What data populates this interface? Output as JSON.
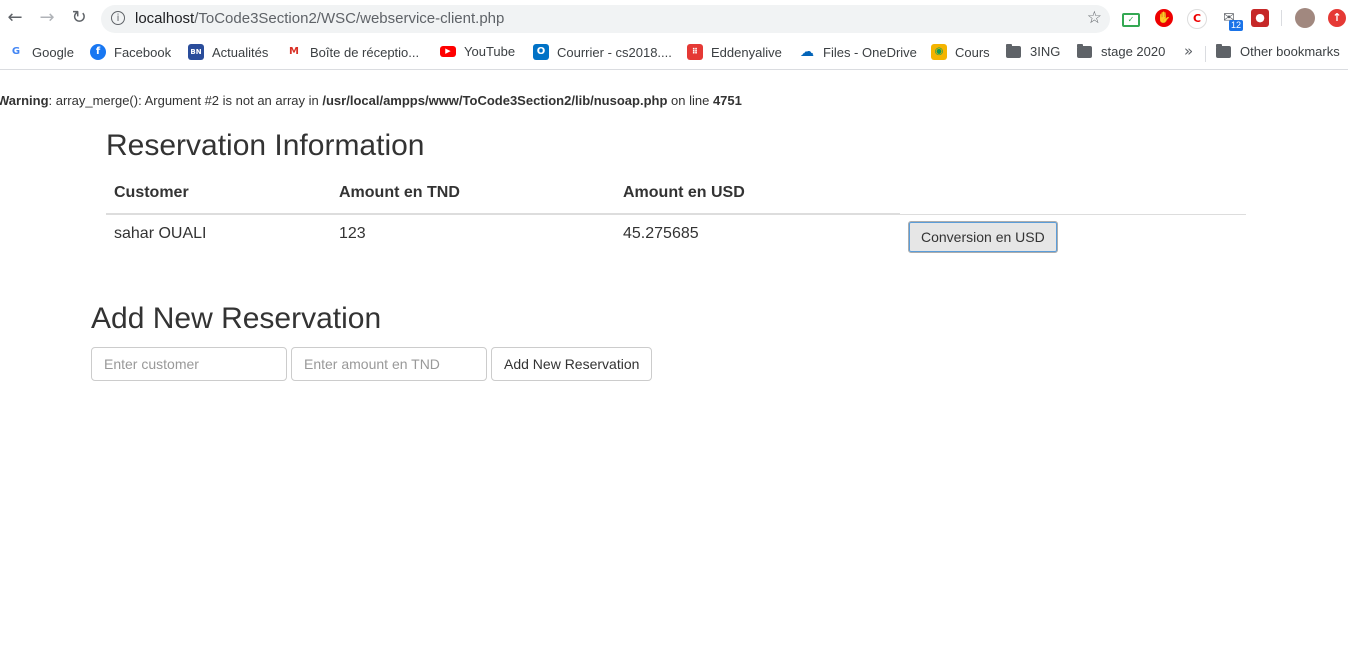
{
  "browser": {
    "url_host": "localhost",
    "url_path": "/ToCode3Section2/WSC/webservice-client.php",
    "mail_badge": "12",
    "extension_c_label": "C"
  },
  "bookmarks": [
    {
      "label": "Google",
      "icon": "google-icon",
      "color": "#4285f4"
    },
    {
      "label": "Facebook",
      "icon": "facebook-icon",
      "color": "#1877f2"
    },
    {
      "label": "Actualités",
      "icon": "news-icon",
      "color": "#2a4d9b"
    },
    {
      "label": "Boîte de réceptio...",
      "icon": "gmail-icon",
      "color": "#d93025"
    },
    {
      "label": "YouTube",
      "icon": "youtube-icon",
      "color": "#ff0000"
    },
    {
      "label": "Courrier - cs2018....",
      "icon": "outlook-icon",
      "color": "#0072c6"
    },
    {
      "label": "Eddenyalive",
      "icon": "grid-icon",
      "color": "#e53935"
    },
    {
      "label": "Files - OneDrive",
      "icon": "cloud-icon",
      "color": "#0364b8"
    },
    {
      "label": "Cours",
      "icon": "classroom-icon",
      "color": "#f4b400"
    },
    {
      "label": "3ING",
      "icon": "folder-icon",
      "color": "#5f6368"
    },
    {
      "label": "stage 2020",
      "icon": "folder-icon",
      "color": "#5f6368"
    },
    {
      "label": "Other bookmarks",
      "icon": "folder-icon",
      "color": "#5f6368"
    }
  ],
  "warning": {
    "prefix": "Warning",
    "message": ": array_merge(): Argument #2 is not an array in ",
    "file": "/usr/local/ampps/www/ToCode3Section2/lib/nusoap.php",
    "on_line": " on line ",
    "line": "4751"
  },
  "reservations": {
    "title": "Reservation Information",
    "headers": [
      "Customer",
      "Amount en TND",
      "Amount en USD"
    ],
    "rows": [
      {
        "customer": "sahar OUALI",
        "amount_tnd": "123",
        "amount_usd": "45.275685",
        "button": "Conversion en USD"
      }
    ]
  },
  "add_form": {
    "title": "Add New Reservation",
    "customer_placeholder": "Enter customer",
    "amount_placeholder": "Enter amount en TND",
    "submit_label": "Add New Reservation"
  }
}
